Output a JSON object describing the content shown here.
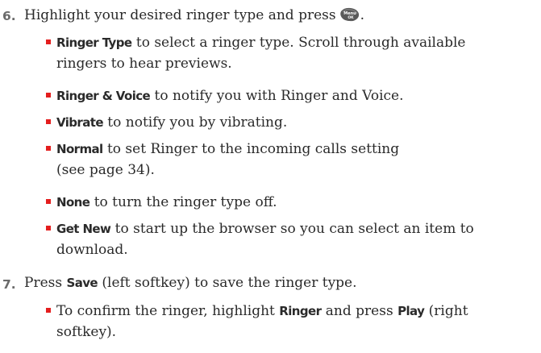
{
  "steps": [
    {
      "number": "6.",
      "text_before": "Highlight your desired ringer type and press",
      "text_after": ".",
      "icon": "menu-ok-key-icon",
      "icon_labels": [
        "Menu",
        "OK"
      ],
      "bullets": [
        {
          "keyword": "Ringer Type",
          "line1": " to select a ringer type. Scroll through available",
          "line2": "ringers to hear previews."
        },
        {
          "keyword": "Ringer & Voice",
          "line1": " to notify you with Ringer and Voice.",
          "line2": ""
        },
        {
          "keyword": "Vibrate",
          "line1": " to notify you by vibrating.",
          "line2": ""
        },
        {
          "keyword": "Normal",
          "line1": " to set Ringer to the incoming calls setting",
          "line2": "(see page 34)."
        },
        {
          "keyword": "None",
          "line1": " to turn the ringer type off.",
          "line2": ""
        },
        {
          "keyword": "Get New",
          "line1": " to start up the browser so you can select an item to",
          "line2": "download."
        }
      ]
    },
    {
      "number": "7.",
      "text_before": "Press ",
      "keyword": "Save",
      "text_after": " (left softkey) to save the ringer type.",
      "bullets": [
        {
          "before": "To confirm the ringer, highlight ",
          "keyword1": "Ringer",
          "middle": " and press ",
          "keyword2": "Play",
          "after": " (right",
          "line2": "softkey)."
        }
      ]
    }
  ],
  "colors": {
    "bullet": "#e41e1e",
    "step_number": "#6b6b6b",
    "text": "#2a2a2a"
  }
}
